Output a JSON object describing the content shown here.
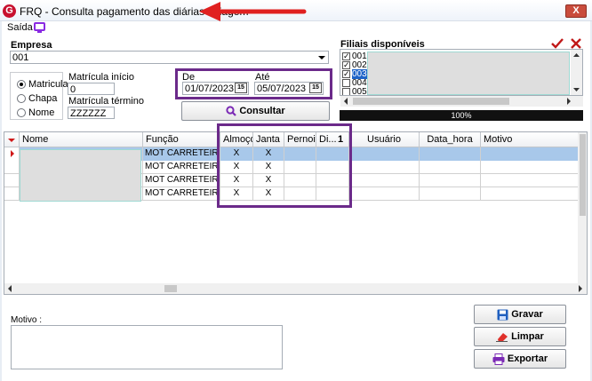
{
  "window": {
    "logo": "G",
    "title": "FRQ - Consulta pagamento das diárias - viagem",
    "close_label": "X"
  },
  "menu": {
    "saida_label": "Saída",
    "screen_icon": "screen-icon"
  },
  "empresa": {
    "label": "Empresa",
    "value": "001"
  },
  "search_by": {
    "options": [
      "Matricula",
      "Chapa",
      "Nome"
    ],
    "selected": "Matricula"
  },
  "matricula": {
    "inicio_label": "Matrícula início",
    "inicio_value": "0",
    "termino_label": "Matrícula término",
    "termino_value": "ZZZZZZ"
  },
  "dates": {
    "de_label": "De",
    "de_value": "01/07/2023",
    "ate_label": "Até",
    "ate_value": "05/07/2023",
    "cal_icon_text": "15"
  },
  "consultar_label": "Consultar",
  "filiais": {
    "label": "Filiais disponíveis",
    "items": [
      {
        "code": "001",
        "checked": true
      },
      {
        "code": "002",
        "checked": true
      },
      {
        "code": "003",
        "checked": true
      },
      {
        "code": "004",
        "checked": false
      },
      {
        "code": "005",
        "checked": false
      }
    ],
    "check_all_icon": "checkmark-icon",
    "uncheck_all_icon": "x-icon",
    "progress_label": "100%",
    "progress_value": 1.0
  },
  "grid": {
    "columns": [
      "Nome",
      "Função",
      "Almoço",
      "Janta",
      "Pernoite",
      "Di...",
      "Usuário",
      "Data_hora",
      "Motivo"
    ],
    "rows": [
      {
        "funcao": "MOT CARRETEIRO",
        "almoco": "X",
        "janta": "X",
        "pernoite": "",
        "di": ""
      },
      {
        "funcao": "MOT CARRETEIRO",
        "almoco": "X",
        "janta": "X",
        "pernoite": "",
        "di": ""
      },
      {
        "funcao": "MOT CARRETEIRO",
        "almoco": "X",
        "janta": "X",
        "pernoite": "",
        "di": ""
      },
      {
        "funcao": "MOT CARRETEIRO",
        "almoco": "X",
        "janta": "X",
        "pernoite": "",
        "di": ""
      }
    ],
    "sort_badge": "1"
  },
  "motivo_label": "Motivo :",
  "buttons": {
    "gravar": "Gravar",
    "limpar": "Limpar",
    "exportar": "Exportar"
  },
  "colors": {
    "annotation_purple": "#6b2a8a",
    "annotation_red": "#e02020",
    "selection_blue": "#a8c8ea"
  }
}
